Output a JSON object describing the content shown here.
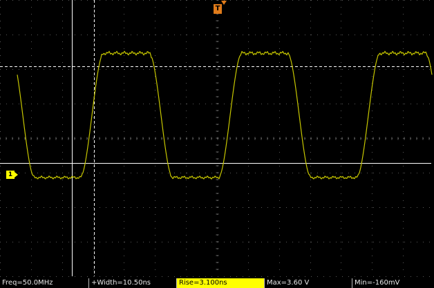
{
  "trigger_marker": {
    "label": "T"
  },
  "channel_marker": {
    "label": "1"
  },
  "measurements": [
    {
      "label": "Freq=50.0MHz",
      "highlighted": false
    },
    {
      "label": "+Width=10.50ns",
      "highlighted": false
    },
    {
      "label": "Rise=3.100ns",
      "highlighted": true
    },
    {
      "label": "Max=3.60 V",
      "highlighted": false
    },
    {
      "label": "Min=-160mV",
      "highlighted": false
    }
  ],
  "colors": {
    "trace": "#c8c800",
    "grid": "#3c3c3c",
    "cursor": "#ffffff",
    "trigger": "#e07b1a",
    "highlight": "#ffff00"
  }
}
